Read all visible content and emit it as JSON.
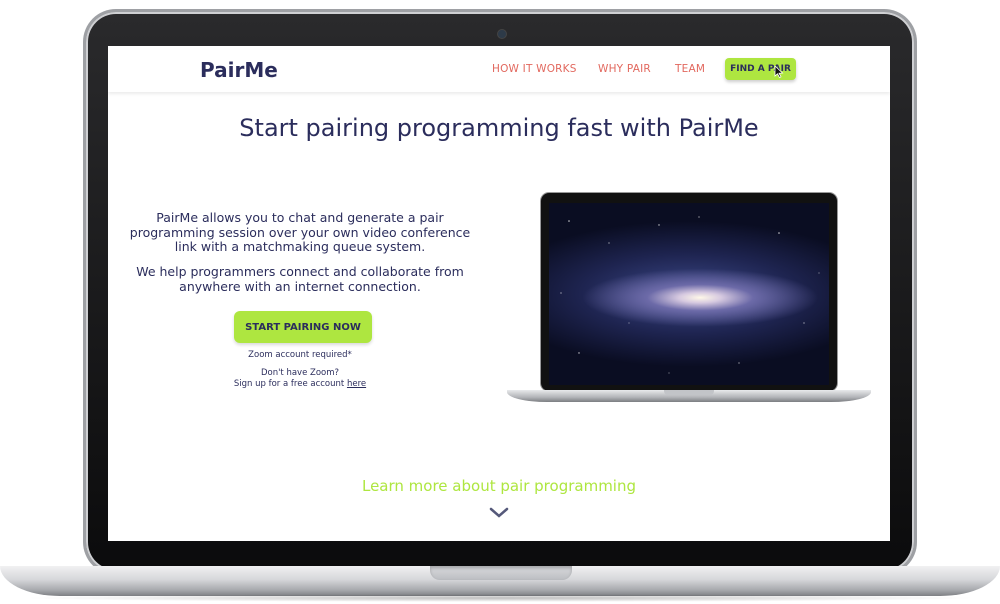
{
  "nav": {
    "logo": "PairMe",
    "links": [
      "HOW IT WORKS",
      "WHY PAIR",
      "TEAM"
    ],
    "cta": "FIND A PAIR"
  },
  "hero": {
    "headline": "Start pairing programming fast with PairMe",
    "paragraph1": "PairMe allows you to chat and generate a pair programming session over your own video conference link with a matchmaking queue system.",
    "paragraph2": "We help programmers connect and collaborate from anywhere with an internet connection.",
    "button": "START PAIRING NOW",
    "zoom_note": "Zoom account required*",
    "zoom_question": "Don't have Zoom?",
    "signup_text": "Sign up for a free account ",
    "signup_link": "here"
  },
  "learn_more": "Learn more about pair programming",
  "icons": {
    "cursor": "arrow-cursor-icon",
    "scroll": "chevron-down-icon"
  },
  "colors": {
    "brand_navy": "#2b2d5c",
    "accent_green": "#aee640",
    "nav_link": "#e2685e"
  }
}
